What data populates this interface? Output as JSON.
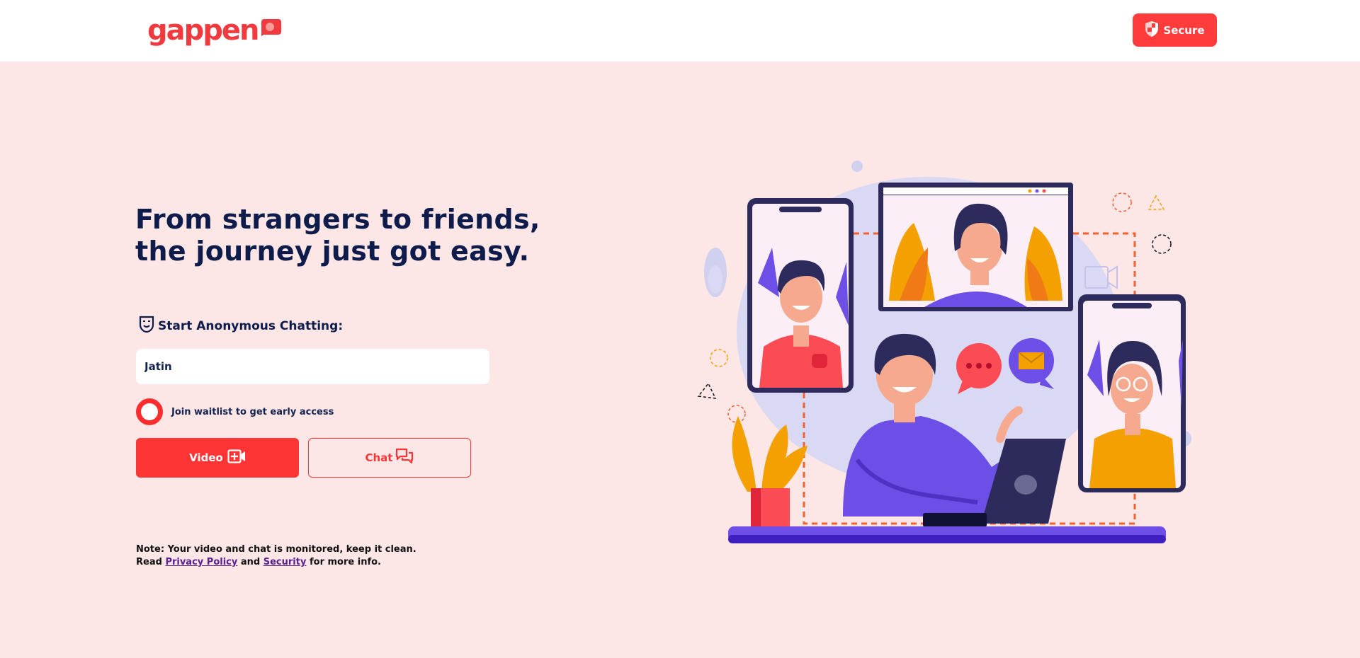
{
  "header": {
    "logo_text": "gappen",
    "secure_label": "Secure"
  },
  "hero": {
    "headline_line1": "From strangers to friends,",
    "headline_line2": "the journey just got easy."
  },
  "form": {
    "anon_label": "Start Anonymous Chatting:",
    "name_value": "Jatin",
    "waitlist_label": "Join waitlist to get early access",
    "video_label": "Video",
    "chat_label": "Chat"
  },
  "note": {
    "line1": "Note: Your video and chat is monitored, keep it clean.",
    "read": "Read",
    "privacy_link": "Privacy Policy",
    "and": "and",
    "security_link": "Security",
    "tail": "for more info."
  },
  "colors": {
    "accent": "#ff3535",
    "page_bg": "#fce6e6",
    "text_dark": "#0e1c4c"
  },
  "icons": [
    "shield-icon",
    "mask-icon",
    "video-plus-icon",
    "chat-bubbles-icon",
    "logo-chat-icon"
  ]
}
